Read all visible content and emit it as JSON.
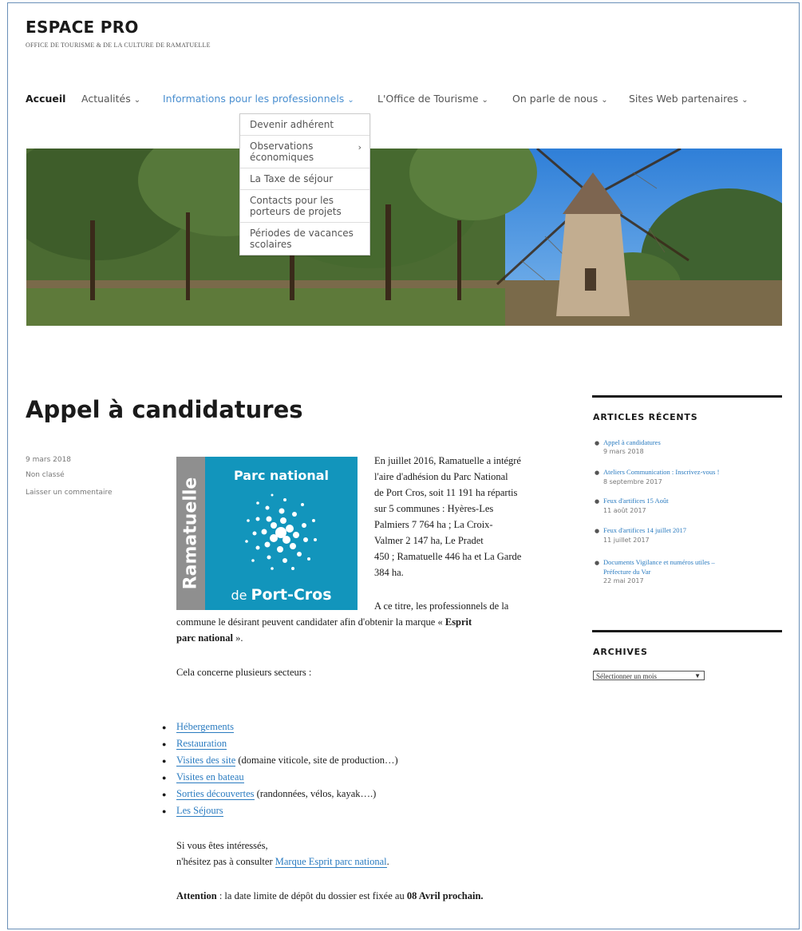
{
  "site": {
    "title": "ESPACE PRO",
    "description": "OFFICE DE TOURISME & DE LA CULTURE DE RAMATUELLE"
  },
  "nav": {
    "items": [
      {
        "label": "Accueil"
      },
      {
        "label": "Actualités"
      },
      {
        "label": "Informations pour les professionnels"
      },
      {
        "label": "L'Office de Tourisme"
      },
      {
        "label": "On parle de nous"
      },
      {
        "label": "Sites Web partenaires"
      }
    ],
    "chevron": "⌄"
  },
  "submenu": {
    "items": [
      {
        "label": "Devenir adhérent"
      },
      {
        "label": "Observations économiques"
      },
      {
        "label": "La Taxe de séjour"
      },
      {
        "label": "Contacts pour les porteurs de projets"
      },
      {
        "label": "Périodes de vacances scolaires"
      }
    ],
    "arrow": "›"
  },
  "post": {
    "title": "Appel à candidatures",
    "meta": {
      "date": "9 mars 2018",
      "category": "Non classé",
      "comment": "Laisser un commentaire"
    },
    "logo": {
      "vertical": "Ramatuelle",
      "top": "Parc national",
      "bottom_prefix": "de ",
      "bottom_bold": "Port-Cros"
    },
    "intro_lines": [
      "En juillet 2016, Ramatuelle a intégré",
      "l'aire d'adhésion du Parc National",
      "de Port Cros, soit 11 191 ha répartis",
      "sur 5 communes :     Hyères-Les",
      "Palmiers 7 764 ha ;     La Croix-",
      "Valmer 2 147 ha,              Le Pradet",
      "450 ; Ramatuelle 446 ha et La Garde",
      "384 ha."
    ],
    "p2_line1": "A ce titre, les professionnels de la",
    "p2_line2": "commune le désirant peuvent candidater afin d'obtenir la marque « ",
    "p2_bold1": "Esprit",
    "p2_bold2": "parc national",
    "p2_end": " ».",
    "p3": "Cela concerne plusieurs secteurs :",
    "sectors": [
      {
        "link": "Hébergements",
        "rest": ""
      },
      {
        "link": "Restauration",
        "rest": ""
      },
      {
        "link": "Visites des site",
        "rest": " (domaine viticole, site de production…)"
      },
      {
        "link": "Visites en bateau",
        "rest": ""
      },
      {
        "link": "Sorties découvertes",
        "rest": " (randonnées, vélos, kayak….)"
      },
      {
        "link": "Les Séjours",
        "rest": ""
      }
    ],
    "p4_line1": "Si vous êtes intéressés,",
    "p4_line2_pre": "n'hésitez pas à consulter ",
    "p4_link": "Marque Esprit parc national",
    "p4_end": ".",
    "p5_bold": "Attention",
    "p5_mid": " : la date limite de dépôt du dossier est fixée au ",
    "p5_bold2": "08 Avril prochain."
  },
  "sidebar": {
    "recent_title": "ARTICLES RÉCENTS",
    "recent": [
      {
        "title": "Appel à candidatures",
        "date": "9 mars 2018"
      },
      {
        "title": "Ateliers Communication : Inscrivez-vous !",
        "date": "8 septembre 2017"
      },
      {
        "title": "Feux d'artifices 15 Août",
        "date": "11 août 2017"
      },
      {
        "title": "Feux d'artifices 14 juillet 2017",
        "date": "11 juillet 2017"
      },
      {
        "title": "Documents Vigilance et numéros utiles –",
        "title2": "Préfecture du Var",
        "date": "22 mai 2017"
      }
    ],
    "archives_title": "ARCHIVES",
    "archives_select": "Sélectionner un mois",
    "archives_arrow": "▼"
  }
}
